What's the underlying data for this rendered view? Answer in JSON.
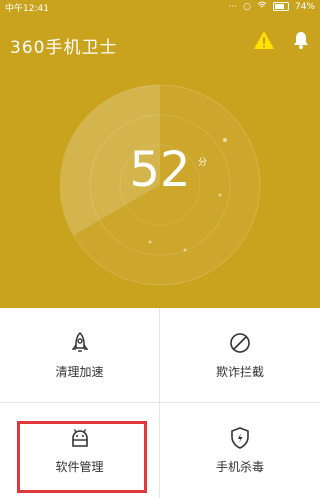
{
  "status": {
    "time": "中午12:41",
    "battery": "74%"
  },
  "header": {
    "title": "360手机卫士"
  },
  "score": {
    "value": "52",
    "unit": "分",
    "fraction": 0.52
  },
  "features": [
    {
      "label": "清理加速",
      "icon": "rocket-icon"
    },
    {
      "label": "欺诈拦截",
      "icon": "block-icon"
    },
    {
      "label": "软件管理",
      "icon": "android-icon"
    },
    {
      "label": "手机杀毒",
      "icon": "shield-bolt-icon"
    }
  ],
  "colors": {
    "top_bg": "#c9a21e",
    "highlight": "#e0383b"
  }
}
